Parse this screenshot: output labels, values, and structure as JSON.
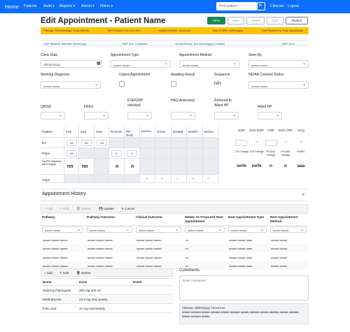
{
  "nav": {
    "brand": "Home",
    "links": [
      "Patients",
      "Audit ▾",
      "Reports ▾",
      "Admin ▾",
      "Filters ▾"
    ],
    "search_placeholder": "Find patient",
    "search_button": "🔍",
    "user": "Clinician",
    "logout": "Logout"
  },
  "page": {
    "title": "Edit Appointment - Patient Name"
  },
  "toolbar": {
    "pifu": "PIFU",
    "save": "Save",
    "reset": "Reset",
    "exit": "Exit",
    "patient": "Patient"
  },
  "strip": [
    "Pathway: Rheumatology - Early Arthritis",
    "NHS Number: nnn nnn nnnn",
    "Hospital Number: nnnnnnnn",
    "Date Of Birth: dd/mm/yyyy",
    "Date Received In Trust: dd/mm/yyyy"
  ],
  "strip2": [
    "HQIP Baseline: Attended dd/mm/yyyy",
    "HQIP 3/12: Completed",
    "Annual Review: Due dd/mm/yyyy (n weeks)",
    "HQIP 12/12: --"
  ],
  "form": {
    "clinic_date_label": "Clinic Date",
    "clinic_date_value": "dd/mm/yyyy",
    "calendar_icon": "▦",
    "appt_type_label": "Appointment Type",
    "appt_type_value": "aaaaa aaaaa",
    "appt_method_label": "Appointment Method",
    "appt_method_value": "aaaaa aaaaa",
    "seen_by_label": "Seen By",
    "seen_by_value": "aaaaa aaaaa",
    "diagnosis_label": "Working Diagnosis",
    "diagnosis_value": "aaaaa aaaaa",
    "urgent_label": "Urgent Appointment",
    "awaiting_label": "Awaiting Result",
    "sequence_label": "Sequence",
    "sequence_value": "n/n",
    "neiaa_label": "NEIAA Consent Status",
    "neiaa_value": "aaaaa aaaaa",
    "qrisk_label": "QRISK",
    "frax_label": "FRAX",
    "esr_label": "ESR/CRP checked",
    "haq_label": "HAQ Assessed",
    "allied_label": "Referred to Allied HP",
    "allied2_label": "Allied HP"
  },
  "scores": {
    "headers": [
      "Pattern",
      "TJS",
      "SJS",
      "VAS",
      "Pt-GAD",
      "Ph-GAD",
      "BASDAI",
      "SVAS",
      "BASMI",
      "BASFI",
      "BASG"
    ],
    "rows": [
      {
        "label": "RA",
        "cells": [
          "nn",
          "nn",
          "nn"
        ]
      },
      {
        "label": "PSpA",
        "cells": [
          "nn",
          "",
          "",
          "n",
          "n"
        ]
      },
      {
        "label": "PsARC Baseline dd/mm/yyyy",
        "cells": [
          "nn",
          "nn",
          "",
          "n",
          "n"
        ]
      },
      {
        "label": "ASpA",
        "cells": [
          "--",
          "--",
          "--",
          "--",
          "--"
        ]
      }
    ],
    "right_headers": [
      "ESR",
      "DAS ESR",
      "CRP",
      "DAS CRP",
      "HAQ"
    ],
    "right_row": [
      "",
      "--",
      "",
      "--",
      "--"
    ],
    "right_sub_headers": [
      "TJS Change",
      "SJS Change",
      "Pt-GAD Change",
      "Ph-GAD Change",
      "PsARC"
    ],
    "right_sub_values": [
      "nn%",
      "nn%",
      "n",
      "n",
      "aaa"
    ]
  },
  "history": {
    "title": "Appointment History",
    "chevron": "⌄",
    "buttons": [
      "+ Add",
      "✎ Edit",
      "🗑 Delete",
      "💾 Update",
      "✕ Cancel"
    ],
    "headers": [
      "Pathway",
      "Pathway Outcome",
      "Clinical Outcome",
      "Weeks To Proposed Next Appointment",
      "Next Appointment Type",
      "Next Appointment Method"
    ],
    "filters": [
      "aaaaa aaaaa",
      "aaaaa aaaaa",
      "aaaaa aaaaa",
      "aaaaa aaaaa",
      "aaaaa aaaaa",
      "aaaaa aaaaa"
    ],
    "rows": [
      [
        "aaaaa aaaaa aaaaa",
        "aaaaa aaaaa aaaaa",
        "aaaaa aaaaa aaaaa",
        "nn",
        "aaaaa aaaaa aaaa",
        "aaaaa aaaaa"
      ],
      [
        "aaaaa aaaaa aaaaa",
        "aaaaa aaaaa aaaaa",
        "aaaaa aaaaa aaaaa",
        "nn",
        "aaaaa aaaaa aaaa",
        "aaaaa aaaaa"
      ],
      [
        "aaaaa aaaaa aaaaa",
        "aaaaa aaaaa aaaaa",
        "aaaaa aaaaa aaaaa",
        "nn",
        "aaaaa aaaaa aaaa",
        "aaaaa aaaaa"
      ],
      [
        "aaaaa aaaaa aaaaa",
        "aaaaa aaaaa aaaaa",
        "aaaaa aaaaa aaaaa",
        "nn",
        "aaaaa aaaaa aaaa",
        "aaaaa aaaaa"
      ]
    ]
  },
  "meds": {
    "buttons": [
      "+ Add",
      "✎ Edit",
      "🗑 Delete"
    ],
    "headers": [
      "Name",
      "Dose",
      "Event"
    ],
    "rows": [
      [
        "Hydroxychloroquine",
        "200 mg oral od"
      ],
      [
        "Methotrexate",
        "22.5 mg oral weekly"
      ],
      [
        "Folic acid",
        "10 mg oral weekly"
      ]
    ]
  },
  "comments": {
    "title": "Comments",
    "placeholder": "Enter comments",
    "history_label": "Clinician: dd/mm/yyyy HH:mm:ss",
    "history_text": "aaaaa aaaaaa aaaaa aaaaaa aaaaa aaaaaa aaaaa aaaaaa aaaaa aaaaaa aaaaa aaaaaa aaaaa aaaaaa aaaaa"
  }
}
